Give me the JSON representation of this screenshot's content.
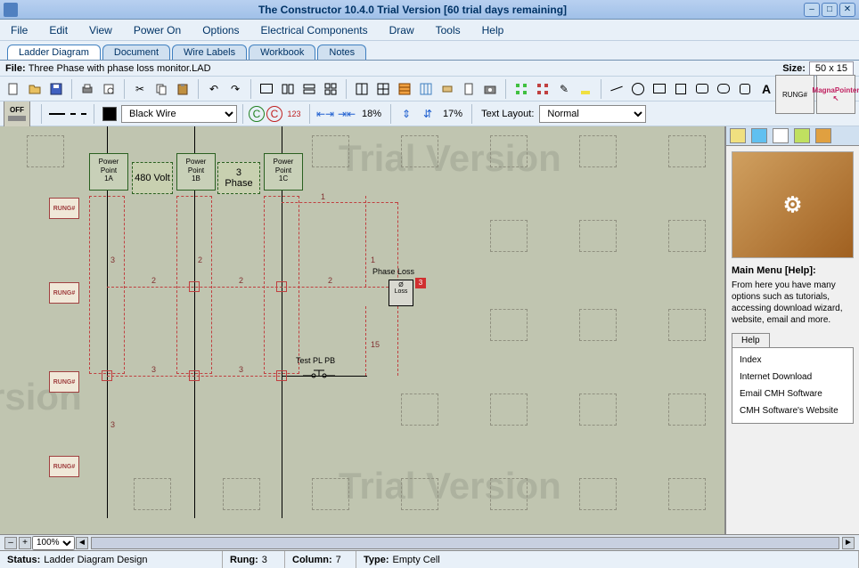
{
  "titlebar": {
    "title": "The Constructor 10.4.0 Trial Version   [60 trial days remaining]"
  },
  "menu": [
    "File",
    "Edit",
    "View",
    "Power On",
    "Options",
    "Electrical Components",
    "Draw",
    "Tools",
    "Help"
  ],
  "tabs": [
    "Ladder Diagram",
    "Document",
    "Wire Labels",
    "Workbook",
    "Notes"
  ],
  "activeTab": 0,
  "fileRow": {
    "label": "File:",
    "name": "Three Phase with phase loss monitor.LAD",
    "sizeLabel": "Size:",
    "size": "50 x 15"
  },
  "toolbar2": {
    "offLabel": "OFF",
    "wireColorLabel": "Black Wire",
    "cLetter": "C",
    "num123": "123",
    "hpct": "18%",
    "vpct": "17%",
    "textLayoutLabel": "Text Layout:",
    "textLayoutVal": "Normal"
  },
  "badges": {
    "rung": "RUNG#",
    "magna": "MagnaPointer"
  },
  "canvas": {
    "rungLabel": "RUNG#",
    "power": [
      "Power\nPoint\n1A",
      "Power\nPoint\n1B",
      "Power\nPoint\n1C"
    ],
    "volt": "480 Volt",
    "phase": "3\nPhase",
    "phaseLoss": "Phase Loss",
    "testPL": "Test PL PB",
    "lossBox": "Ø\nLoss",
    "num3red": "3",
    "wireNums": {
      "n1": "1",
      "n2": "2",
      "n3": "3",
      "n15": "15"
    }
  },
  "sidepanel": {
    "title": "Main Menu [Help]:",
    "text": "From here you have many options such as tutorials, accessing download wizard, website, email and more.",
    "helpTab": "Help",
    "items": [
      "Index",
      "Internet Download",
      "Email CMH Software",
      "CMH Software's Website"
    ]
  },
  "zoom": {
    "value": "100%"
  },
  "status": {
    "statusLabel": "Status:",
    "statusVal": "Ladder Diagram Design",
    "rungLabel": "Rung:",
    "rungVal": "3",
    "colLabel": "Column:",
    "colVal": "7",
    "typeLabel": "Type:",
    "typeVal": "Empty Cell"
  }
}
